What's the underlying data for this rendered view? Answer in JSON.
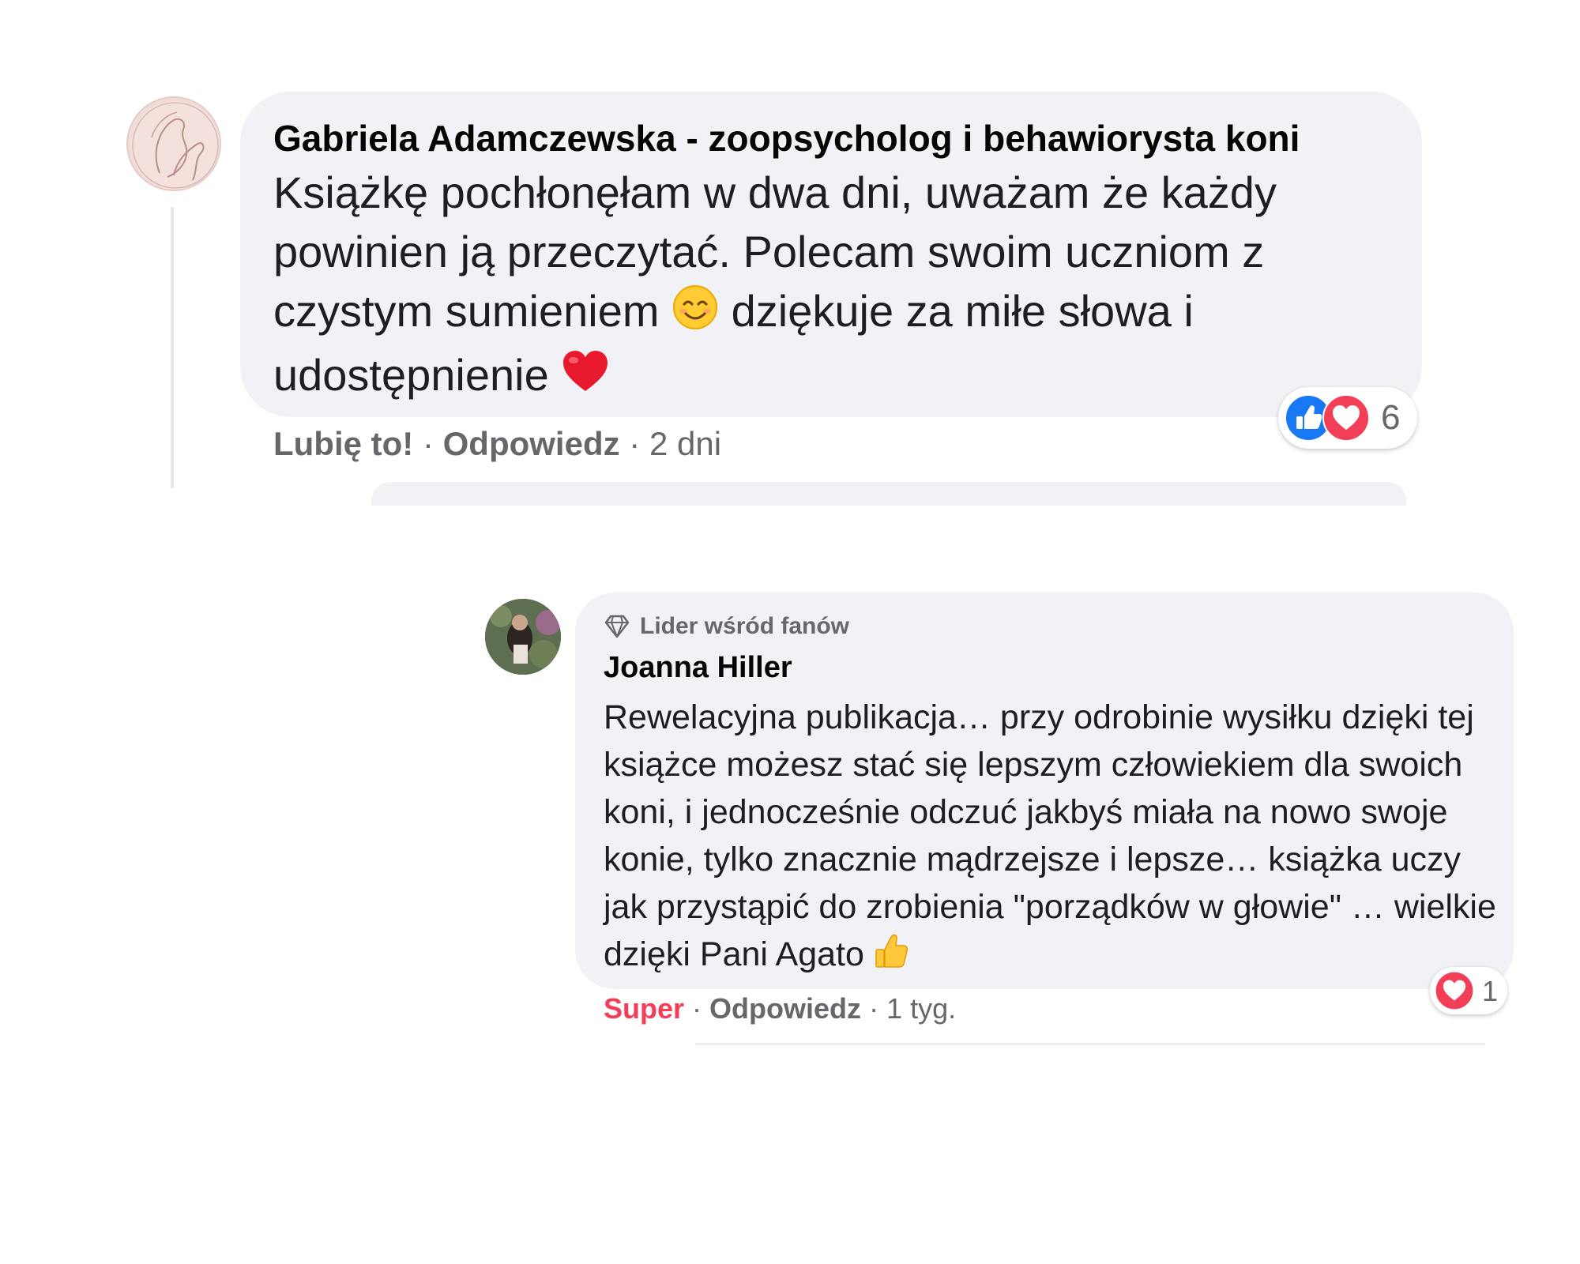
{
  "comments": [
    {
      "author": "Gabriela Adamczewska - zoopsycholog i behawiorysta koni",
      "text_part1": "Książkę pochłonęłam w dwa dni, uważam że każdy powinien ją przeczytać. Polecam swoim uczniom z czystym sumieniem",
      "text_part2": "dziękuje za miłe słowa i udostępnienie",
      "like_label": "Lubię to!",
      "reply_label": "Odpowiedz",
      "time": "2 dni",
      "reaction_count": "6",
      "reaction_icons": [
        "like-icon",
        "love-icon"
      ],
      "inline_emojis": [
        "smiling-face-icon",
        "red-heart-icon"
      ]
    },
    {
      "badge": "Lider wśród fanów",
      "author": "Joanna Hiller",
      "text": "Rewelacyjna publikacja… przy odrobinie wysiłku dzięki tej książce możesz stać się lepszym człowiekiem dla swoich koni, i jednocześnie odczuć jakbyś miała na nowo swoje konie, tylko znacznie mądrzejsze i lepsze… książka uczy jak przystąpić do zrobienia \"porządków w głowie\" … wielkie dzięki Pani Agato",
      "like_label": "Super",
      "reply_label": "Odpowiedz",
      "time": "1 tyg.",
      "reaction_count": "1",
      "reaction_icons": [
        "love-icon"
      ],
      "inline_emojis": [
        "thumbs-up-icon"
      ]
    }
  ],
  "colors": {
    "bubble": "#f0f2f5",
    "meta_text": "#65676b",
    "like_blue": "#1877f2",
    "love_red": "#f33e58"
  }
}
